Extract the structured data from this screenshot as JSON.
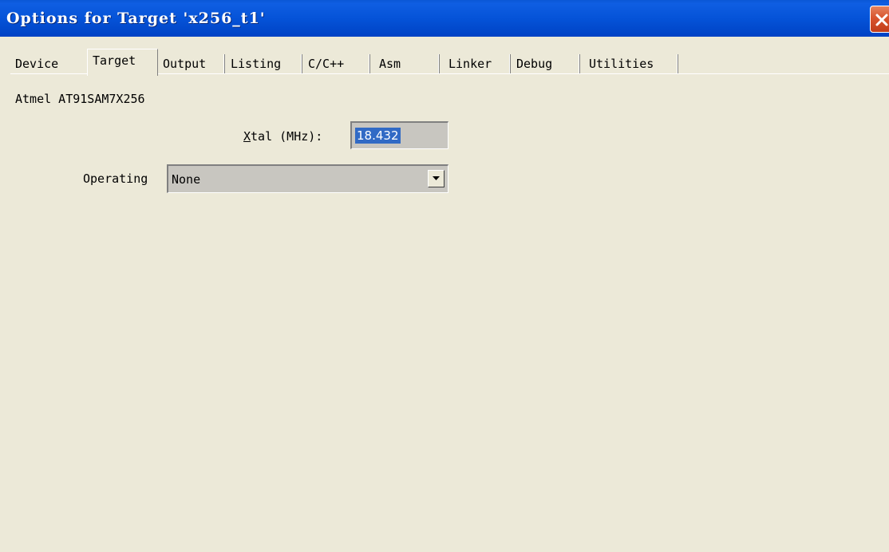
{
  "window": {
    "title": "Options for Target 'x256_t1'"
  },
  "tabs": [
    {
      "label": "Device",
      "active": false
    },
    {
      "label": "Target",
      "active": true
    },
    {
      "label": "Output",
      "active": false
    },
    {
      "label": "Listing",
      "active": false
    },
    {
      "label": "C/C++",
      "active": false
    },
    {
      "label": "Asm",
      "active": false
    },
    {
      "label": "Linker",
      "active": false
    },
    {
      "label": "Debug",
      "active": false
    },
    {
      "label": "Utilities",
      "active": false
    }
  ],
  "target": {
    "device_name": "Atmel AT91SAM7X256",
    "xtal_label_first": "X",
    "xtal_label_rest": "tal (MHz):",
    "xtal_value": "18.432",
    "operating_label": "Operating",
    "operating_value": "None"
  },
  "colors": {
    "titlebar": "#0553d8",
    "background": "#ece9d8",
    "selection": "#316ac5",
    "close_button": "#d8542e"
  },
  "icons": {
    "close": "close-icon",
    "dropdown": "chevron-down-icon"
  }
}
